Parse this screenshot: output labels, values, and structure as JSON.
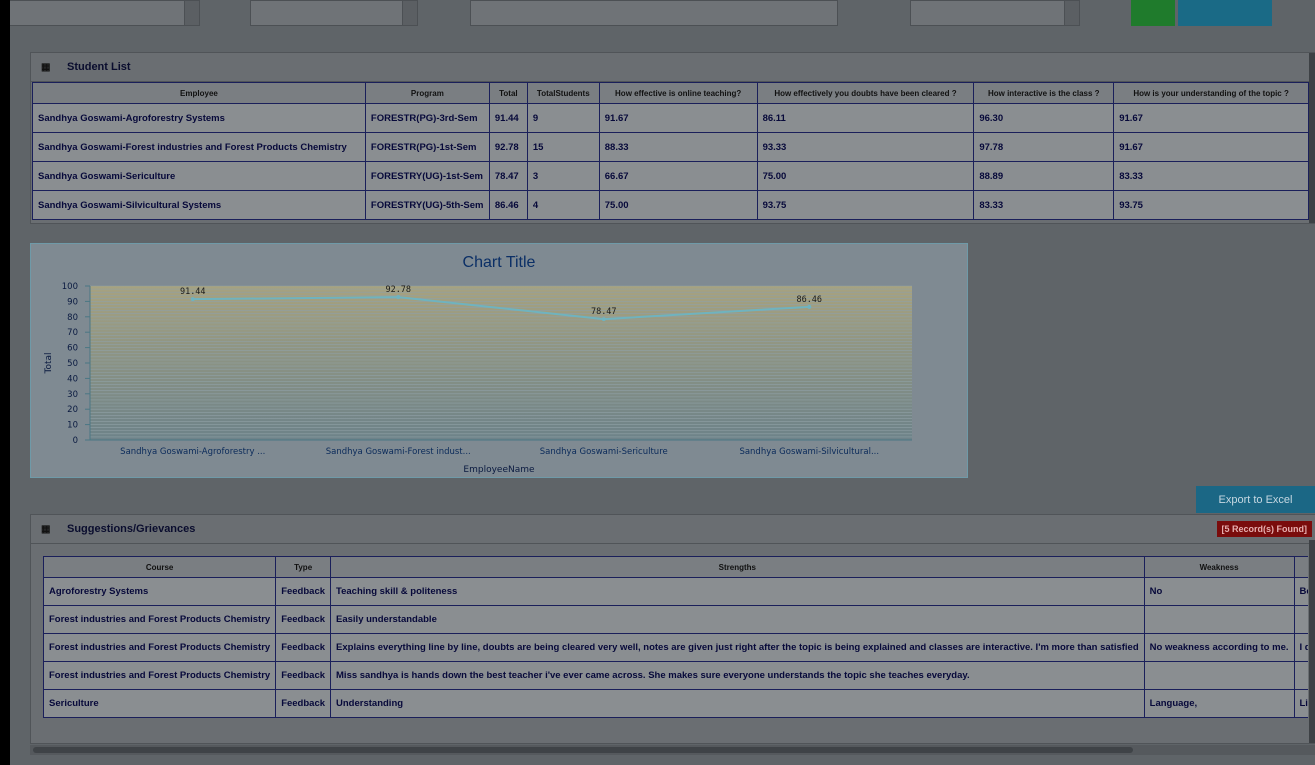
{
  "student_list": {
    "title": "Student List",
    "columns": [
      "Employee",
      "Program",
      "Total",
      "TotalStudents",
      "How effective is online teaching?",
      "How effectively you doubts have been cleared ?",
      "How interactive is the class ?",
      "How is your understanding of the topic ?"
    ],
    "rows": [
      [
        "Sandhya Goswami-Agroforestry Systems",
        "FORESTR(PG)-3rd-Sem",
        "91.44",
        "9",
        "91.67",
        "86.11",
        "96.30",
        "91.67"
      ],
      [
        "Sandhya Goswami-Forest industries and Forest Products Chemistry",
        "FORESTR(PG)-1st-Sem",
        "92.78",
        "15",
        "88.33",
        "93.33",
        "97.78",
        "91.67"
      ],
      [
        "Sandhya Goswami-Sericulture",
        "FORESTRY(UG)-1st-Sem",
        "78.47",
        "3",
        "66.67",
        "75.00",
        "88.89",
        "83.33"
      ],
      [
        "Sandhya Goswami-Silvicultural Systems",
        "FORESTRY(UG)-5th-Sem",
        "86.46",
        "4",
        "75.00",
        "93.75",
        "83.33",
        "93.75"
      ]
    ]
  },
  "chart_data": {
    "type": "line",
    "title": "Chart Title",
    "xlabel": "EmployeeName",
    "ylabel": "Total",
    "categories": [
      "Sandhya  Goswami-Agroforestry ...",
      "Sandhya  Goswami-Forest indust...",
      "Sandhya  Goswami-Sericulture",
      "Sandhya  Goswami-Silvicultural..."
    ],
    "series": [
      {
        "values": [
          91.44,
          92.78,
          78.47,
          86.46
        ]
      }
    ],
    "data_labels": [
      "91.44",
      "92.78",
      "78.47",
      "86.46"
    ],
    "ylim": [
      0,
      100
    ],
    "yticks": [
      "0",
      "10",
      "20",
      "30",
      "40",
      "50",
      "60",
      "70",
      "80",
      "90",
      "100"
    ],
    "line_color": "#6fb3bf"
  },
  "export_button": "Export to Excel",
  "suggestions": {
    "title": "Suggestions/Grievances",
    "badge": "[5 Record(s) Found]",
    "columns": [
      "Course",
      "Type",
      "Strengths",
      "Weakness",
      ""
    ],
    "rows": [
      [
        "Agroforestry Systems",
        "Feedback",
        "Teaching skill & politeness",
        "No",
        "Best teache"
      ],
      [
        "Forest industries and Forest Products Chemistry",
        "Feedback",
        "Easily understandable",
        "",
        ""
      ],
      [
        "Forest industries and Forest Products Chemistry",
        "Feedback",
        "Explains everything line by line, doubts are being cleared very well, notes are given just right after the topic is being explained and classes are interactive. I'm more than satisfied",
        "No weakness according to me.",
        "I don't think"
      ],
      [
        "Forest industries and Forest Products Chemistry",
        "Feedback",
        "Miss sandhya is hands down the best teacher i've ever came across. She makes sure everyone understands the topic she teaches everyday.",
        "",
        ""
      ],
      [
        "Sericulture",
        "Feedback",
        "Understanding",
        "Language,",
        "Like to ask y"
      ]
    ]
  }
}
